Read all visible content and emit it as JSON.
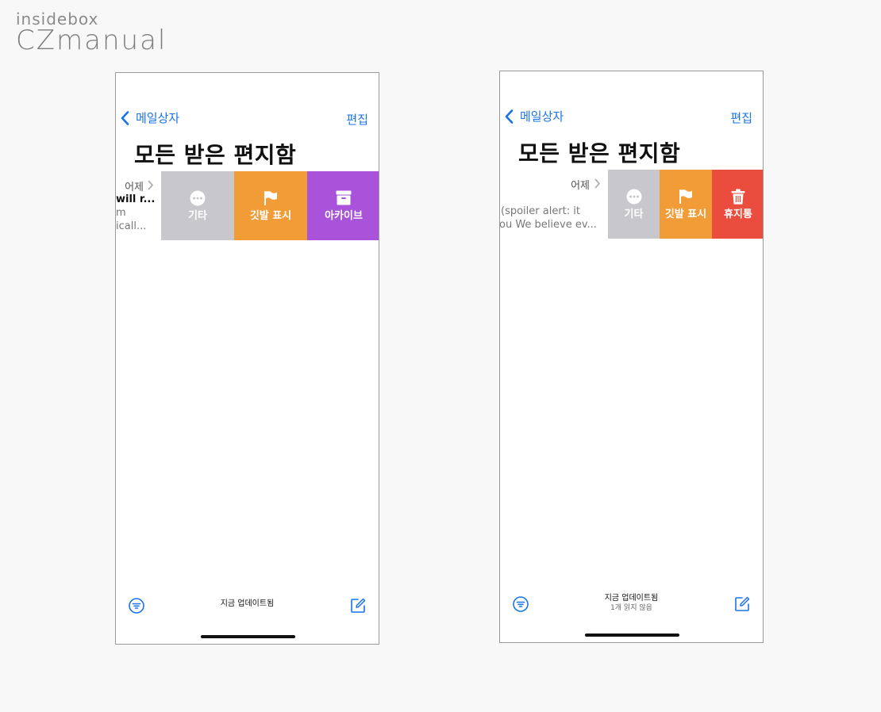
{
  "logo": {
    "top": "insidebox",
    "bottom": "CZmanual"
  },
  "screens": [
    {
      "nav": {
        "back_label": "메일상자",
        "edit_label": "편집"
      },
      "title": "모든 받은 편지함",
      "mail": {
        "date": "어제",
        "line1": "will r...",
        "line2": "m",
        "line3": "icall..."
      },
      "actions": [
        {
          "label": "기타",
          "icon": "ellipsis-circle-icon",
          "color": "#c7c7cc"
        },
        {
          "label": "깃발 표시",
          "icon": "flag-icon",
          "color": "#f29c38"
        },
        {
          "label": "아카이브",
          "icon": "archive-box-icon",
          "color": "#a853d9"
        }
      ],
      "status": "지금 업데이트됨"
    },
    {
      "nav": {
        "back_label": "메일상자",
        "edit_label": "편집"
      },
      "title": "모든 받은 편지함",
      "mail": {
        "date": "어제",
        "line2": "(spoiler alert: it",
        "line3": "ou We believe ev..."
      },
      "actions": [
        {
          "label": "기타",
          "icon": "ellipsis-circle-icon",
          "color": "#c7c7cc"
        },
        {
          "label": "깃발 표시",
          "icon": "flag-icon",
          "color": "#f29c38"
        },
        {
          "label": "휴지통",
          "icon": "trash-icon",
          "color": "#ea4d3d"
        }
      ],
      "status": "지금 업데이트됨",
      "status_sub": "1개 읽지 않음"
    }
  ]
}
